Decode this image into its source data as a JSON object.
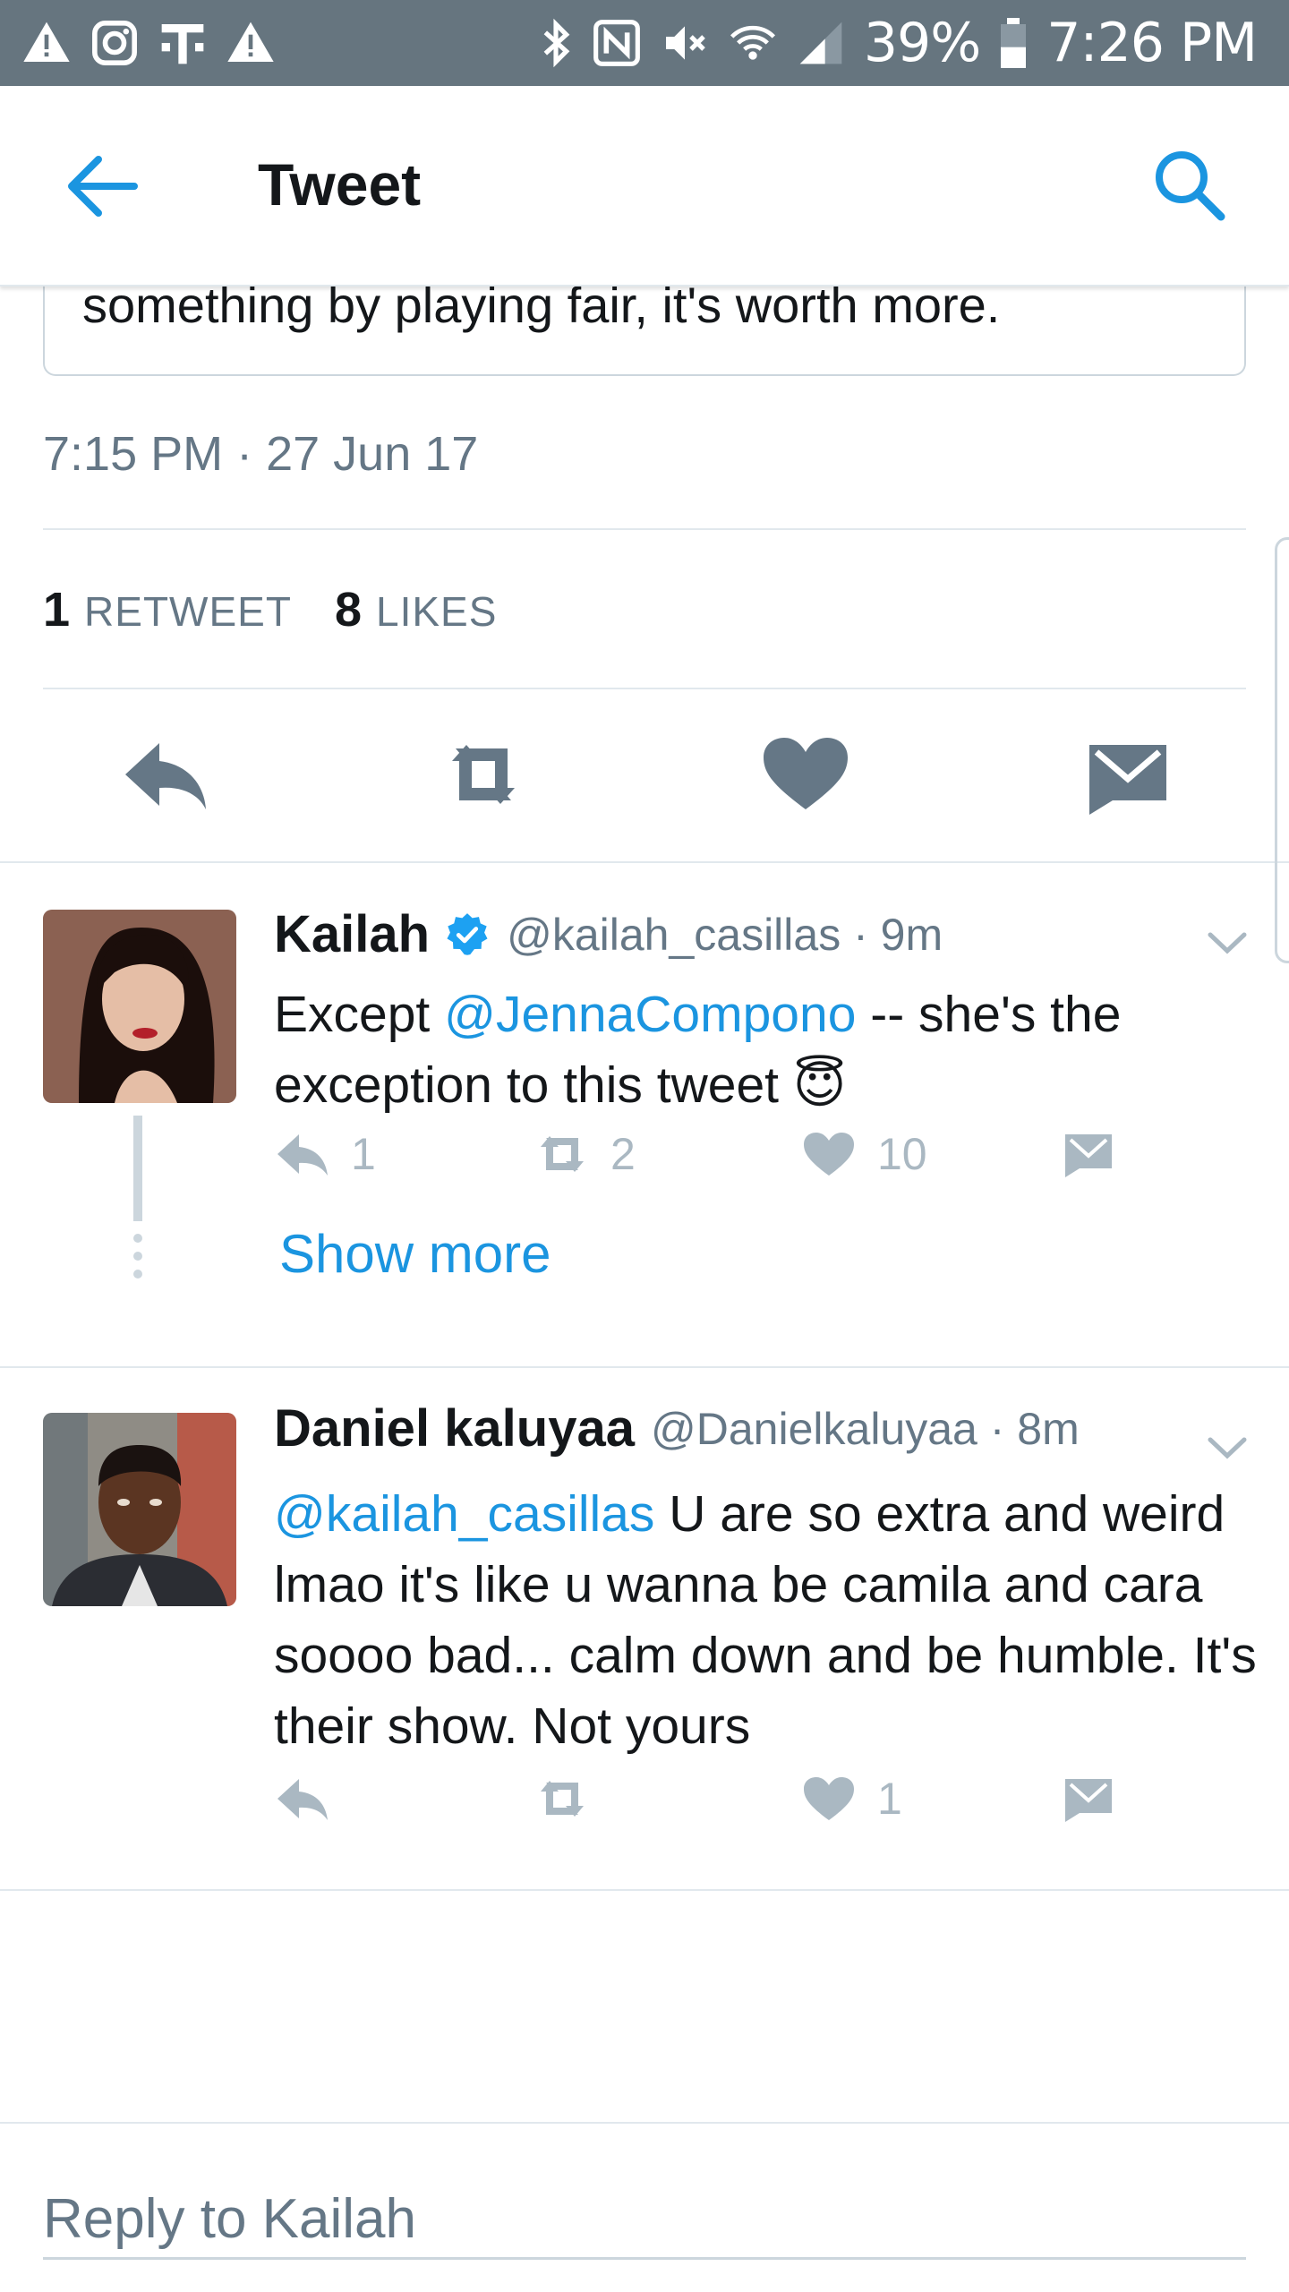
{
  "status_bar": {
    "battery": "39%",
    "time": "7:26 PM",
    "left_icons": [
      "warning-icon",
      "instagram-icon",
      "tmobile-icon",
      "warning-icon"
    ],
    "right_icons": [
      "bluetooth-icon",
      "nfc-icon",
      "mute-icon",
      "wifi-icon",
      "signal-icon",
      "battery-icon"
    ]
  },
  "header": {
    "title": "Tweet",
    "accent": "#1b95e0"
  },
  "tweet": {
    "quoted_text_tail": "something by playing fair, it's worth more.",
    "timestamp": "7:15 PM · 27 Jun 17",
    "retweet_count": "1",
    "retweet_label": "RETWEET",
    "like_count": "8",
    "like_label": "LIKES"
  },
  "replies": [
    {
      "name": "Kailah",
      "verified": true,
      "handle": "@kailah_casillas · 9m",
      "body_prefix": "Except ",
      "mention": "@JennaCompono",
      "body_suffix": " -- she's the exception to this tweet 😇",
      "reply_count": "1",
      "retweet_count": "2",
      "like_count": "10",
      "show_more": "Show more"
    },
    {
      "name": "Daniel kaluyaa",
      "verified": false,
      "handle": "@Danielkaluyaa · 8m",
      "mention": "@kailah_casillas",
      "body_suffix": " U are so extra and weird lmao it's like u wanna be camila and cara soooo bad... calm down and be humble. It's their show. Not yours",
      "reply_count": "",
      "retweet_count": "",
      "like_count": "1"
    }
  ],
  "reply_box": {
    "placeholder": "Reply to Kailah"
  }
}
